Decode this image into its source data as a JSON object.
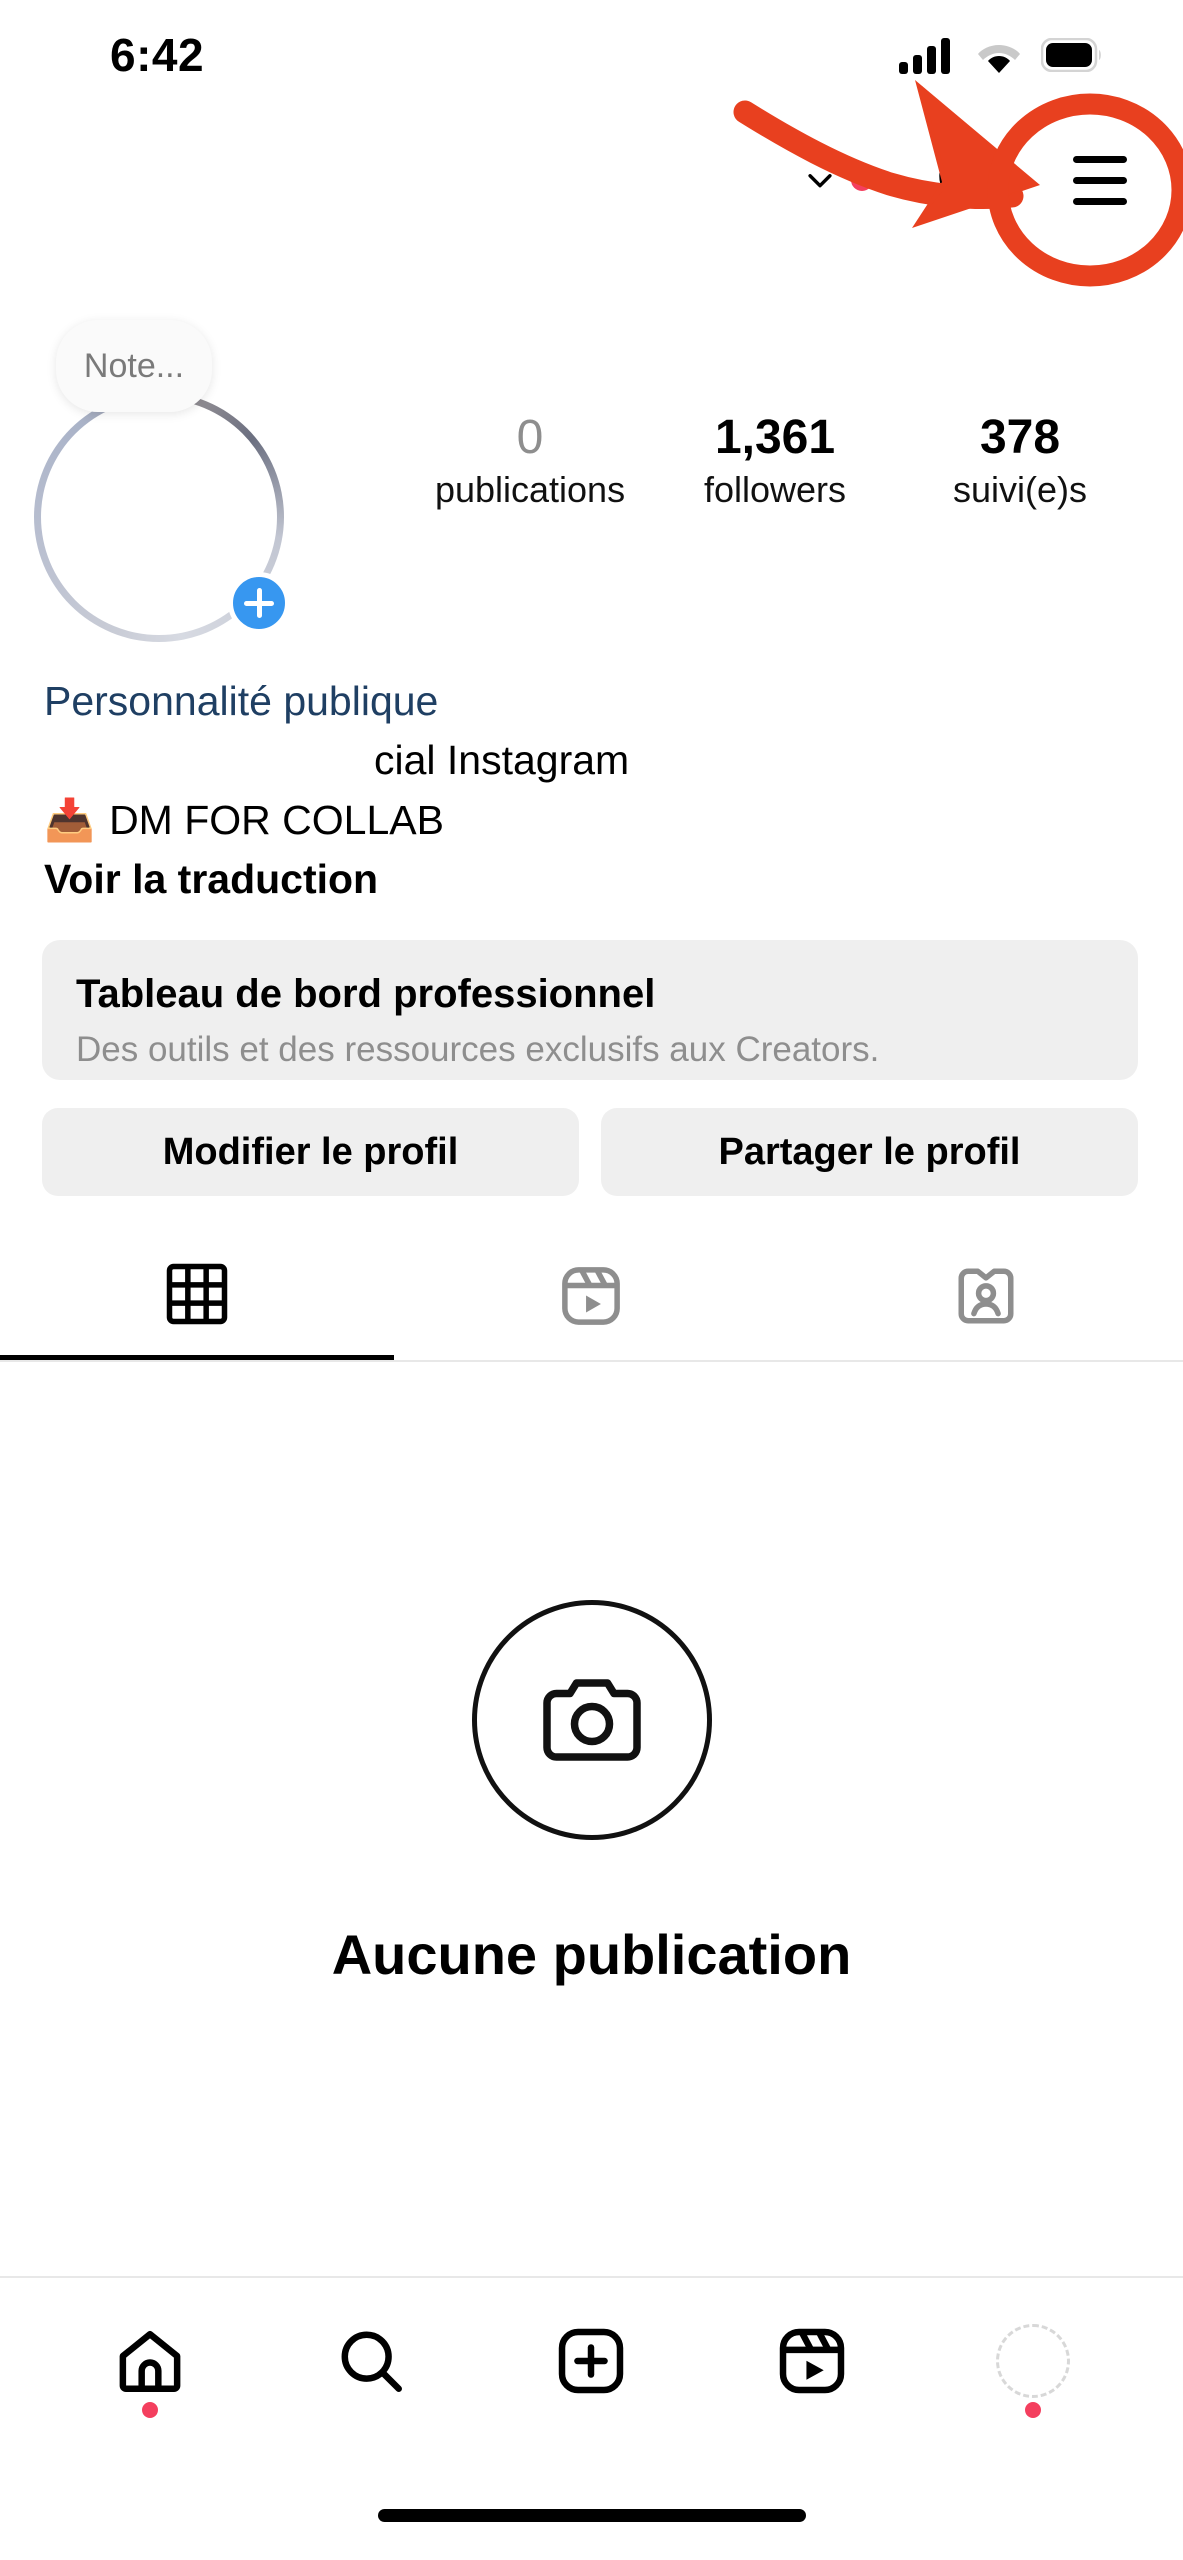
{
  "status_bar": {
    "time": "6:42",
    "signal_icon": "cellular-signal-icon",
    "wifi_icon": "wifi-icon",
    "battery_icon": "battery-full-icon"
  },
  "header": {
    "chevron_icon": "chevron-down-icon",
    "notification_dot": "notification-dot",
    "threads_icon": "threads-icon",
    "menu_icon": "hamburger-menu-icon"
  },
  "annotation": {
    "arrow": "red-arrow-annotation",
    "circle": "red-circle-annotation",
    "color": "#E8401F"
  },
  "profile": {
    "note_placeholder": "Note...",
    "avatar": "profile-avatar",
    "add_story_badge": "plus-badge",
    "stats": [
      {
        "value": "0",
        "label": "publications",
        "muted": true
      },
      {
        "value": "1,361",
        "label": "followers",
        "muted": false
      },
      {
        "value": "378",
        "label": "suivi(e)s",
        "muted": false
      }
    ]
  },
  "bio": {
    "category": "Personnalité publique",
    "line2": "cial Instagram",
    "emoji": "📥",
    "line3": "DM FOR COLLAB",
    "translate": "Voir la traduction"
  },
  "dashboard": {
    "title": "Tableau de bord professionnel",
    "subtitle": "Des outils et des ressources exclusifs aux Creators."
  },
  "actions": {
    "edit_profile": "Modifier le profil",
    "share_profile": "Partager le profil"
  },
  "tabs": [
    {
      "name": "grid-tab",
      "icon": "grid-icon",
      "active": true
    },
    {
      "name": "reels-tab",
      "icon": "reels-icon",
      "active": false
    },
    {
      "name": "tagged-tab",
      "icon": "tagged-icon",
      "active": false
    }
  ],
  "empty_state": {
    "icon": "camera-icon",
    "title": "Aucune publication"
  },
  "bottom_nav": [
    {
      "name": "home-tab",
      "icon": "home-icon",
      "dot": true
    },
    {
      "name": "search-tab",
      "icon": "search-icon",
      "dot": false
    },
    {
      "name": "create-tab",
      "icon": "plus-square-icon",
      "dot": false
    },
    {
      "name": "reels-tab",
      "icon": "reels-icon",
      "dot": false
    },
    {
      "name": "profile-tab",
      "icon": "profile-avatar-icon",
      "dot": true
    }
  ]
}
